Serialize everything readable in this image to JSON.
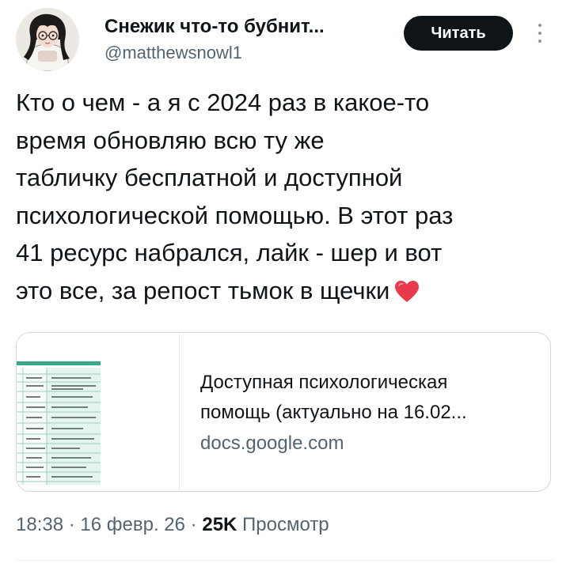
{
  "author": {
    "display_name": "Снежик что-то бубнит...",
    "handle": "@matthewsnowl1",
    "avatar": "avatar-illustration"
  },
  "follow_button": {
    "label": "Читать"
  },
  "more_icon": "more-vertical-icon",
  "tweet": {
    "lines": [
      "Кто о чем - а я с 2024 раз в какое-то",
      "время обновляю всю ту же",
      "табличку бесплатной и доступной",
      "психологической помощью. В этот раз",
      "41 ресурс набрался, лайк - шер и вот",
      "это все, за репост тьмок в щечки"
    ],
    "emoji": "heart-icon"
  },
  "link_card": {
    "title_lines": [
      "Доступная психологическая",
      "помощь (актуально на 16.02..."
    ],
    "domain": "docs.google.com",
    "thumbnail": "spreadsheet-thumbnail"
  },
  "meta": {
    "time": "18:38",
    "sep1": "·",
    "date": "16 февр. 26",
    "sep2": "·",
    "views": "25K",
    "views_label": "Просмотр"
  },
  "colors": {
    "text": "#0f1419",
    "secondary": "#536471",
    "button_bg": "#0f1419",
    "button_text": "#ffffff",
    "heart": "#e8394d",
    "border": "#cfd9de"
  }
}
